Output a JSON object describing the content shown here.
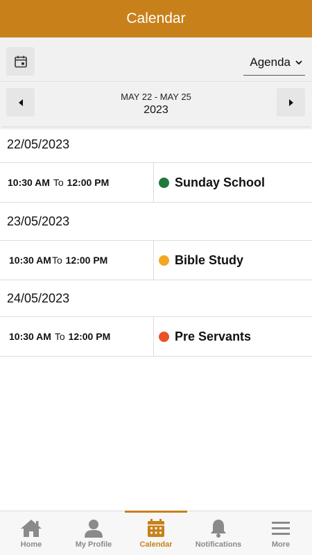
{
  "header": {
    "title": "Calendar"
  },
  "toolbar": {
    "view_selected": "Agenda"
  },
  "date_nav": {
    "range": "MAY 22 - MAY 25",
    "year": "2023"
  },
  "agenda": {
    "days": [
      {
        "date": "22/05/2023",
        "events": [
          {
            "start": "10:30 AM",
            "to": "To",
            "end": "12:00 PM",
            "title": "Sunday School",
            "color": "#1e7a3a"
          }
        ]
      },
      {
        "date": "23/05/2023",
        "events": [
          {
            "start": "10:30 AM",
            "to": "To",
            "end": "12:00 PM",
            "title": "Bible Study",
            "color": "#f0a722"
          }
        ]
      },
      {
        "date": "24/05/2023",
        "events": [
          {
            "start": "10:30 AM",
            "to": "To",
            "end": "12:00 PM",
            "title": "Pre Servants",
            "color": "#e9522a"
          }
        ]
      }
    ]
  },
  "tabbar": {
    "items": [
      {
        "label": "Home",
        "icon": "home-icon"
      },
      {
        "label": "My Profile",
        "icon": "profile-icon"
      },
      {
        "label": "Calendar",
        "icon": "calendar-icon",
        "active": true
      },
      {
        "label": "Notifications",
        "icon": "bell-icon"
      },
      {
        "label": "More",
        "icon": "menu-icon"
      }
    ]
  },
  "colors": {
    "brand": "#c8811a",
    "inactive_tab": "#8a8a8a"
  }
}
